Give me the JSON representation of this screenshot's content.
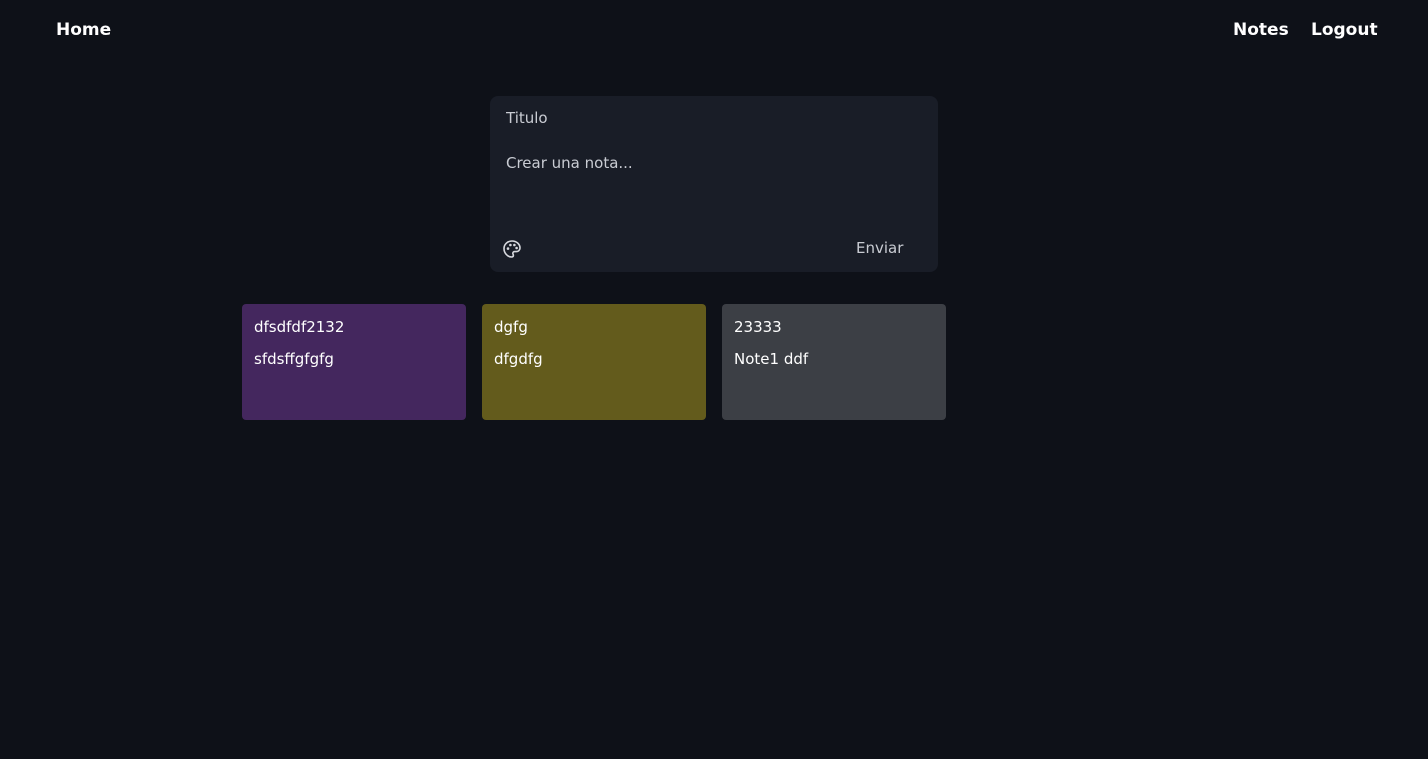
{
  "nav": {
    "home": "Home",
    "notes": "Notes",
    "logout": "Logout"
  },
  "composer": {
    "title_placeholder": "Titulo",
    "body_placeholder": "Crear una nota...",
    "palette_icon": "palette-icon",
    "send_label": "Enviar"
  },
  "notes": [
    {
      "title": "dfsdfdf2132",
      "body": "sfdsffgfgfg",
      "color": "#44275e"
    },
    {
      "title": "dgfg",
      "body": "dfgdfg",
      "color": "#635b1c"
    },
    {
      "title": "23333",
      "body": "Note1 ddf",
      "color": "#3c3f45"
    }
  ]
}
